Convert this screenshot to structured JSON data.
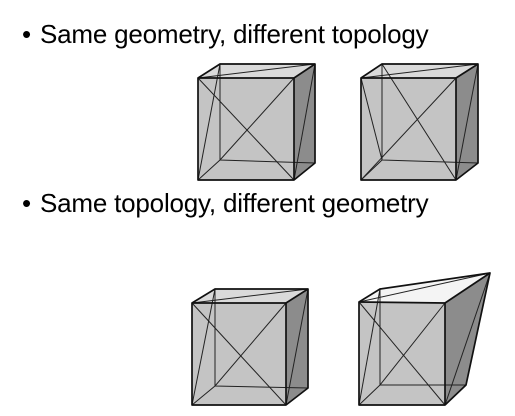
{
  "bullets": [
    {
      "marker": "•",
      "text": "Same geometry, different topology"
    },
    {
      "marker": "•",
      "text": "Same topology, different geometry"
    }
  ],
  "figures": [
    {
      "row": "same-geometry",
      "cube": "left",
      "shape": "cube",
      "diagonal": "top-left-to-bottom-right"
    },
    {
      "row": "same-geometry",
      "cube": "right",
      "shape": "cube",
      "diagonal": "top-right-to-bottom-left"
    },
    {
      "row": "same-topology",
      "cube": "left",
      "shape": "cube"
    },
    {
      "row": "same-topology",
      "cube": "right",
      "shape": "deformed-cube"
    }
  ]
}
